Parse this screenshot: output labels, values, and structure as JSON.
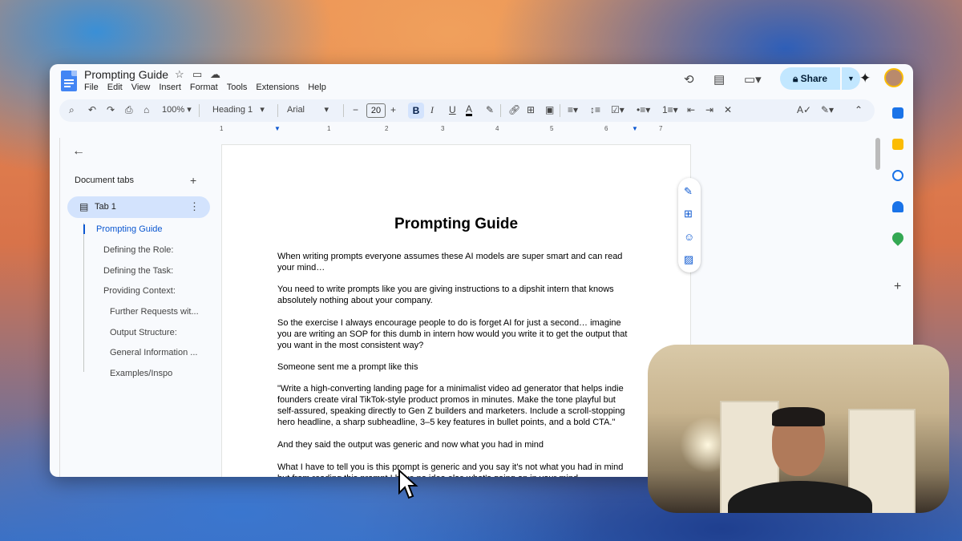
{
  "doc": {
    "title": "Prompting Guide"
  },
  "menu": [
    "File",
    "Edit",
    "View",
    "Insert",
    "Format",
    "Tools",
    "Extensions",
    "Help"
  ],
  "header": {
    "share_label": "Share"
  },
  "toolbar": {
    "zoom": "100%",
    "style": "Heading 1",
    "font": "Arial",
    "font_size": "20",
    "bold": "B",
    "italic": "I",
    "underline": "U",
    "text_color": "A"
  },
  "ruler": [
    "1",
    "1",
    "2",
    "3",
    "4",
    "5",
    "6",
    "7"
  ],
  "sidebar": {
    "header": "Document tabs",
    "tab": "Tab 1",
    "outline": [
      {
        "label": "Prompting Guide",
        "level": 1,
        "active": true
      },
      {
        "label": "Defining the Role:",
        "level": 2
      },
      {
        "label": "Defining the Task:",
        "level": 2
      },
      {
        "label": "Providing Context:",
        "level": 2
      },
      {
        "label": "Further Requests wit...",
        "level": 3
      },
      {
        "label": "Output Structure:",
        "level": 3
      },
      {
        "label": "General Information ...",
        "level": 3
      },
      {
        "label": "Examples/Inspo",
        "level": 3
      }
    ]
  },
  "page": {
    "heading": "Prompting Guide",
    "paragraphs": [
      "When writing prompts everyone assumes these AI models are super smart and can read your mind…",
      "You need to write prompts like you are giving instructions to a dipshit intern that knows absolutely nothing about your company.",
      "So the exercise I always encourage people to do is forget AI for just a second… imagine you are writing an SOP for this dumb in intern how would you write it to get the output that you want in the most consistent way?",
      "Someone sent me a prompt like this",
      "\"Write a high-converting landing page for a minimalist video ad generator that helps indie founders create viral TikTok-style product promos in minutes. Make the tone playful but self-assured, speaking directly to Gen Z builders and marketers. Include a scroll-stopping hero headline, a sharp subheadline, 3–5 key features in bullet points, and a bold CTA.\"",
      "And they said the output was generic and now what you had in mind",
      "What I have to tell you is this prompt is generic and you say it's not what you had in mind but from reading this prompt I have no idea else what's going on in your mind"
    ]
  }
}
